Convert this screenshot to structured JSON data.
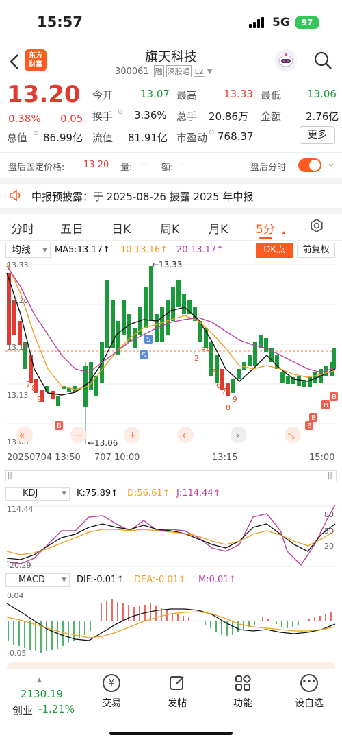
{
  "status_bar": {
    "time": "15:57",
    "network": "5G",
    "battery": "97"
  },
  "header": {
    "logo_line1": "东方",
    "logo_line2": "财富",
    "stock_name": "旗天科技",
    "stock_code": "300061",
    "tag1": "融",
    "tag2": "深股通",
    "tag3": "L2"
  },
  "quote": {
    "price": "13.20",
    "change_pct": "0.38%",
    "change": "0.05",
    "open_label": "今开",
    "open": "13.07",
    "high_label": "最高",
    "high": "13.33",
    "low_label": "最低",
    "low": "13.06",
    "turnover_label": "换手",
    "turnover": "3.36%",
    "volume_label": "总手",
    "volume": "20.86万",
    "amount_label": "金额",
    "amount": "2.76亿",
    "mcap_label": "总值",
    "mcap": "86.99亿",
    "float_label": "流值",
    "float": "81.91亿",
    "pe_label": "市盈动",
    "pe": "768.37",
    "more": "更多"
  },
  "after_hours": {
    "label": "盘后固定价格:",
    "price": "13.20",
    "vol_label": "量:",
    "vol": "--",
    "amt_label": "额:",
    "amt": "--",
    "toggle_label": "盘后分时"
  },
  "notice": {
    "text": "中报预披露：于 2025-08-26 披露 2025 年中报"
  },
  "tabs": [
    "分时",
    "五日",
    "日K",
    "周K",
    "月K",
    "5分"
  ],
  "chart_bar": {
    "indicator": "均线",
    "ma5": "MA5:13.17↑",
    "ma10": "10:13.16↑",
    "ma20": "20:13.17↑",
    "dk": "DK点",
    "adjust": "前复权"
  },
  "price_axis": {
    "top": "13.33",
    "mid1": "13.26",
    "mid2": "13.19",
    "mid3": "13.13",
    "bottom": "13.06"
  },
  "annotations": {
    "high": "←13.33",
    "low": "←13.06"
  },
  "time_axis": {
    "t1": "20250704 13:50",
    "t2": "707 10:00",
    "t3": "13:15",
    "t4": "15:00"
  },
  "kdj": {
    "name": "KDJ",
    "k": "K:75.89↑",
    "d": "D:56.61↑",
    "j": "J:114.44↑",
    "max": "114.44",
    "min": "-20.29",
    "l80": "80",
    "l50": "50",
    "l20": "20"
  },
  "macd": {
    "name": "MACD",
    "dif": "DIF:-0.01↑",
    "dea": "DEA:-0.01↑",
    "m": "M:0.01↑",
    "max": "0.04",
    "min": "-0.05"
  },
  "index": {
    "value": "2130.19",
    "name": "创业",
    "change": "-1.21%"
  },
  "nav": [
    "交易",
    "发帖",
    "功能",
    "设自选"
  ],
  "colors": {
    "up": "#e23a30",
    "down": "#1a9a3a",
    "ma5": "#111111",
    "ma10": "#f0a020",
    "ma20": "#c040a0",
    "accent": "#ff5a1f"
  }
}
